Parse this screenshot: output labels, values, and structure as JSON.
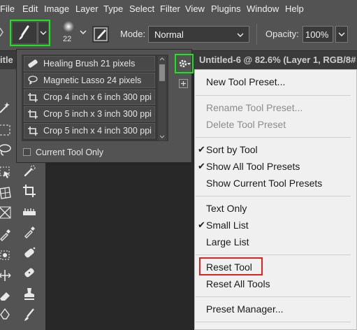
{
  "menubar": {
    "items": [
      "File",
      "Edit",
      "Image",
      "Layer",
      "Type",
      "Select",
      "Filter",
      "View",
      "Plugins",
      "Window",
      "Help"
    ]
  },
  "options_bar": {
    "brush_size": "22",
    "mode_label": "Mode:",
    "mode_value": "Normal",
    "opacity_label": "Opacity:",
    "opacity_value": "100%",
    "highlight_color": "#18e818"
  },
  "document_tab": {
    "left_partial": "itle",
    "title": "Untitled-6 @ 82.6% (Layer 1, RGB/8#"
  },
  "tool_presets": {
    "items": [
      {
        "label": "Healing Brush 21 pixels",
        "icon": "healing-brush-icon"
      },
      {
        "label": "Magnetic Lasso 24 pixels",
        "icon": "magnetic-lasso-icon"
      },
      {
        "label": "Crop 4 inch x 6 inch 300 ppi",
        "icon": "crop-icon"
      },
      {
        "label": "Crop 5 inch x 3 inch 300 ppi",
        "icon": "crop-icon"
      },
      {
        "label": "Crop 5 inch x 4 inch 300 ppi",
        "icon": "crop-icon"
      }
    ],
    "current_tool_only_label": "Current Tool Only",
    "current_tool_only_checked": false
  },
  "flyout_menu": {
    "items": [
      {
        "label": "New Tool Preset...",
        "enabled": true
      },
      {
        "label": "Rename Tool Preset...",
        "enabled": false
      },
      {
        "label": "Delete Tool Preset",
        "enabled": false
      },
      {
        "label": "Sort by Tool",
        "enabled": true,
        "checked": true
      },
      {
        "label": "Show All Tool Presets",
        "enabled": true,
        "checked": true
      },
      {
        "label": "Show Current Tool Presets",
        "enabled": true
      },
      {
        "label": "Text Only",
        "enabled": true
      },
      {
        "label": "Small List",
        "enabled": true,
        "checked": true
      },
      {
        "label": "Large List",
        "enabled": true
      },
      {
        "label": "Reset Tool",
        "enabled": true,
        "highlighted": true
      },
      {
        "label": "Reset All Tools",
        "enabled": true
      },
      {
        "label": "Preset Manager...",
        "enabled": true
      }
    ],
    "check_glyph": "✔",
    "highlight_color": "#e22020"
  }
}
